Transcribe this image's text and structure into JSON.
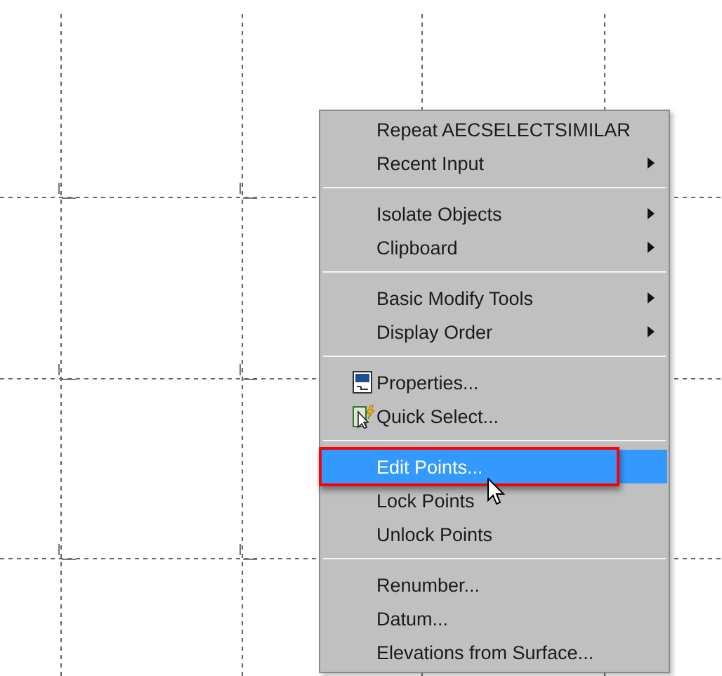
{
  "context_menu": {
    "groups": [
      {
        "items": [
          {
            "label": "Repeat AECSELECTSIMILAR",
            "submenu": false,
            "selected": false,
            "framed": false
          },
          {
            "label": "Recent Input",
            "submenu": true,
            "selected": false,
            "framed": false
          }
        ]
      },
      {
        "items": [
          {
            "label": "Isolate Objects",
            "submenu": true,
            "selected": false,
            "framed": false
          },
          {
            "label": "Clipboard",
            "submenu": true,
            "selected": false,
            "framed": false
          }
        ]
      },
      {
        "items": [
          {
            "label": "Basic Modify Tools",
            "submenu": true,
            "selected": false,
            "framed": false
          },
          {
            "label": "Display Order",
            "submenu": true,
            "selected": false,
            "framed": false
          }
        ]
      },
      {
        "items": [
          {
            "label": "Properties...",
            "submenu": false,
            "selected": false,
            "framed": false,
            "kind": "properties"
          },
          {
            "label": "Quick Select...",
            "submenu": false,
            "selected": false,
            "framed": false,
            "kind": "quick-select"
          }
        ]
      },
      {
        "items": [
          {
            "label": "Edit Points...",
            "submenu": false,
            "selected": true,
            "framed": true
          },
          {
            "label": "Lock Points",
            "submenu": false,
            "selected": false,
            "framed": false
          },
          {
            "label": "Unlock Points",
            "submenu": false,
            "selected": false,
            "framed": false
          }
        ]
      },
      {
        "items": [
          {
            "label": "Renumber...",
            "submenu": false,
            "selected": false,
            "framed": false
          },
          {
            "label": "Datum...",
            "submenu": false,
            "selected": false,
            "framed": false
          },
          {
            "label": "Elevations from Surface...",
            "submenu": false,
            "selected": false,
            "framed": false
          }
        ]
      }
    ]
  }
}
